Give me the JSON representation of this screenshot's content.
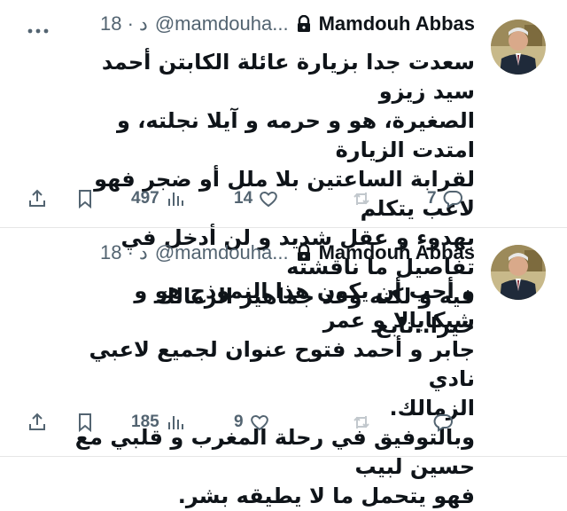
{
  "tweets": [
    {
      "author_name": "Mamdouh Abbas",
      "handle": "@mamdouha...",
      "time": "18 · د",
      "lines": [
        "سعدت جدا بزيارة عائلة الكابتن أحمد سيد زيزو",
        "الصغيرة، هو و حرمه و آيلا نجلته، و امتدت الزيارة",
        "لقرابة الساعتين بلا ملل أو ضجر فهو لاعب يتكلم",
        "بهدوء و عقل شديد و لن أدخل في تفاصيل ما ناقشته",
        "فيه و لكنه وعد جماهير الزمالك خيرا..تابع"
      ],
      "replies": "7",
      "retweets": "",
      "likes": "14",
      "views": "497"
    },
    {
      "author_name": "Mamdouh Abbas",
      "handle": "@mamdouha...",
      "time": "18 · د",
      "lines": [
        "و أحب أن يكون هذا النموذج هو و شيكابالا و عمر",
        "جابر و أحمد فتوح عنوان لجميع لاعبي نادي",
        "الزمالك.",
        "وبالتوفيق في رحلة المغرب و قلبي مع حسين لبيب",
        "فهو يتحمل ما لا يطيقه بشر."
      ],
      "replies": "",
      "retweets": "",
      "likes": "9",
      "views": "185"
    }
  ],
  "icons": {
    "more": "more-horizontal-icon",
    "lock": "lock-icon",
    "reply": "reply-bubble-icon",
    "retweet": "retweet-icon",
    "like": "heart-icon",
    "views": "views-bar-chart-icon",
    "bookmark": "bookmark-icon",
    "share": "share-upload-icon"
  },
  "colors": {
    "text": "#0f1419",
    "muted": "#536471",
    "divider": "#e6e6e6"
  }
}
